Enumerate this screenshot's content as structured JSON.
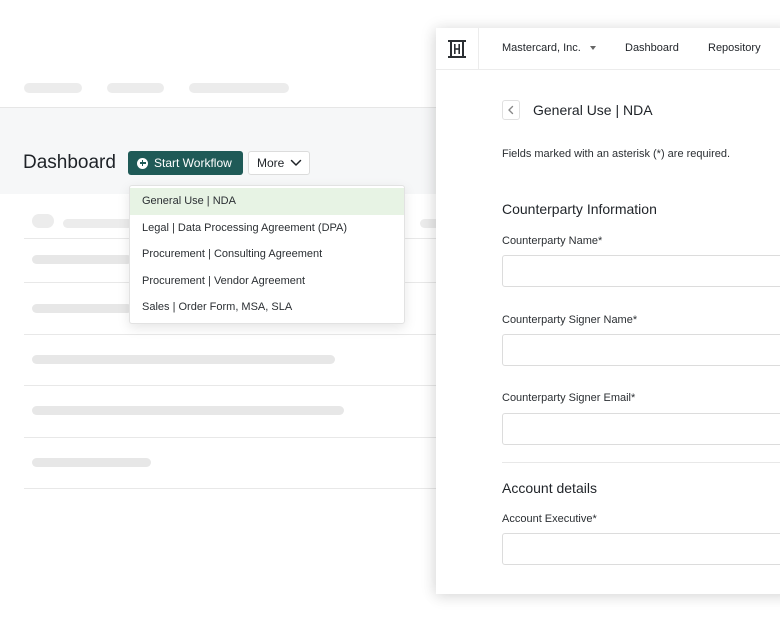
{
  "dashboard": {
    "title": "Dashboard",
    "start_workflow_label": "Start Workflow",
    "more_label": "More"
  },
  "workflow_menu": {
    "items": [
      {
        "label": "General Use | NDA",
        "selected": true
      },
      {
        "label": "Legal | Data Processing Agreement (DPA)",
        "selected": false
      },
      {
        "label": "Procurement | Consulting Agreement",
        "selected": false
      },
      {
        "label": "Procurement | Vendor Agreement",
        "selected": false
      },
      {
        "label": "Sales | Order Form, MSA, SLA",
        "selected": false
      }
    ]
  },
  "panel": {
    "nav": {
      "company": "Mastercard, Inc.",
      "dashboard": "Dashboard",
      "repository": "Repository"
    },
    "form_title": "General Use | NDA",
    "required_note": "Fields marked with an asterisk (*) are required.",
    "sections": {
      "counterparty": "Counterparty Information",
      "account": "Account details"
    },
    "fields": {
      "counterparty_name": {
        "label": "Counterparty Name*",
        "value": ""
      },
      "signer_name": {
        "label": "Counterparty Signer Name*",
        "value": ""
      },
      "signer_email": {
        "label": "Counterparty Signer Email*",
        "value": ""
      },
      "account_executive": {
        "label": "Account Executive*",
        "value": ""
      }
    }
  },
  "colors": {
    "accent": "#1f5a57",
    "selected_row": "#e7f3e4",
    "skeleton": "#e7e7e7"
  },
  "icons": [
    "plus-circle-icon",
    "chevron-down-icon",
    "logo-icon",
    "caret-down-icon",
    "chevron-left-icon"
  ]
}
